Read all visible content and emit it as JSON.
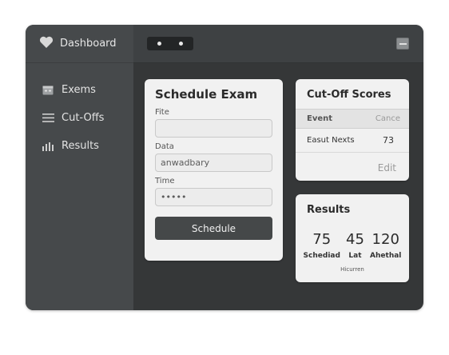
{
  "app": {
    "title": "Dashboard"
  },
  "sidebar": {
    "items": [
      {
        "label": "Exems",
        "icon": "calendar-icon"
      },
      {
        "label": "Cut-Offs",
        "icon": "menu-lines-icon"
      },
      {
        "label": "Results",
        "icon": "bar-chart-icon"
      }
    ]
  },
  "schedule": {
    "title": "Schedule Exam",
    "fields": [
      {
        "label": "Fite",
        "value": ""
      },
      {
        "label": "Data",
        "value": "anwadbary"
      },
      {
        "label": "Time",
        "value": "•••••"
      }
    ],
    "button": "Schedule"
  },
  "cutoff": {
    "title": "Cut-Off Scores",
    "headers": [
      "Event",
      "Cance"
    ],
    "rows": [
      {
        "event": "Easut Nexts",
        "score": "73"
      }
    ],
    "edit": "Edit"
  },
  "results": {
    "title": "Results",
    "stats": [
      {
        "value": "75",
        "label": "Schediad"
      },
      {
        "value": "45",
        "label": "Lat"
      },
      {
        "value": "120",
        "label": "Ahethal"
      }
    ],
    "footnote": "Hicurren"
  },
  "colors": {
    "sidebar": "#46494b",
    "main": "#353738",
    "card": "#f1f1f1",
    "button": "#454849"
  }
}
